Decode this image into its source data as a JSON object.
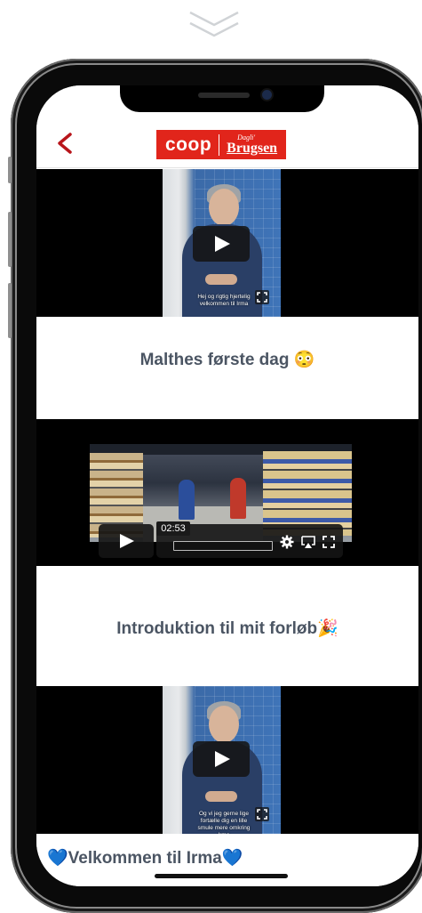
{
  "header": {
    "brand_left": "coop",
    "brand_small": "Dagli'",
    "brand_right": "Brugsen"
  },
  "videos": [
    {
      "subtitle": "Hej og rigtig hjertelig velkommen til Irma"
    },
    {
      "caption": "Malthes første dag 😳"
    },
    {
      "time": "02:53"
    },
    {
      "caption": "Introduktion til mit forløb🎉"
    },
    {
      "subtitle": "Og vi jeg gerne lige fortælle dig en lille smule mere omkring Irma"
    }
  ],
  "footer": {
    "title": "💙Velkommen til Irma💙"
  },
  "colors": {
    "brand_red": "#e1251b",
    "back_arrow": "#b8151b",
    "caption_text": "#4b5563"
  }
}
